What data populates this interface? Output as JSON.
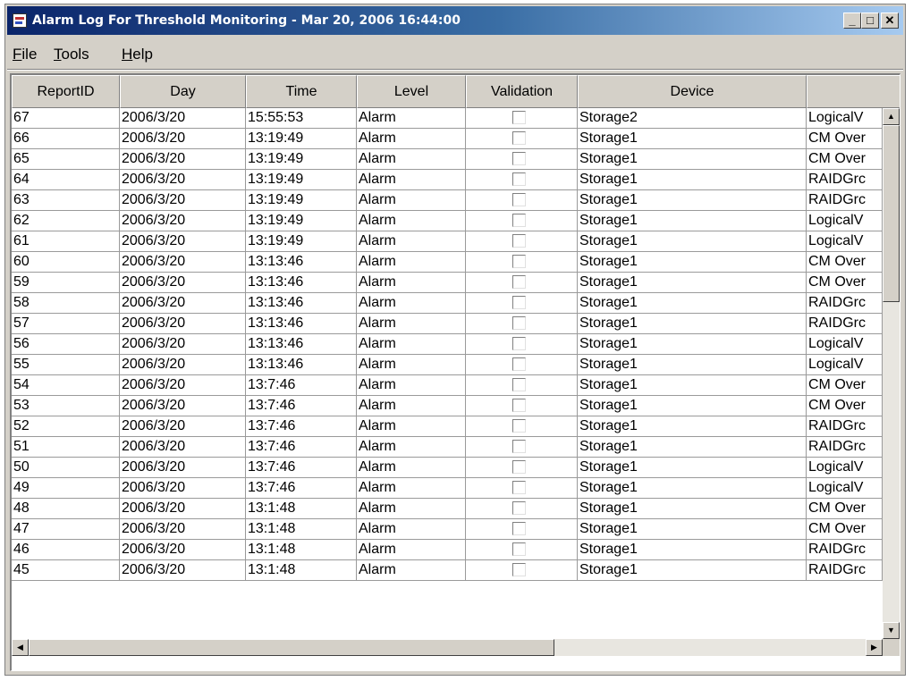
{
  "window": {
    "title": "Alarm Log For Threshold Monitoring - Mar 20, 2006 16:44:00",
    "minimize_label": "_",
    "maximize_label": "□",
    "close_label": "✕"
  },
  "menu": {
    "file_mnemonic": "F",
    "file_rest": "ile",
    "tools_mnemonic": "T",
    "tools_rest": "ools",
    "help_mnemonic": "H",
    "help_rest": "elp"
  },
  "table": {
    "columns": [
      "ReportID",
      "Day",
      "Time",
      "Level",
      "Validation",
      "Device",
      ""
    ],
    "rows": [
      {
        "id": "67",
        "day": "2006/3/20",
        "time": "15:55:53",
        "level": "Alarm",
        "validation": false,
        "device": "Storage2",
        "extra": "LogicalV"
      },
      {
        "id": "66",
        "day": "2006/3/20",
        "time": "13:19:49",
        "level": "Alarm",
        "validation": false,
        "device": "Storage1",
        "extra": "CM Over"
      },
      {
        "id": "65",
        "day": "2006/3/20",
        "time": "13:19:49",
        "level": "Alarm",
        "validation": false,
        "device": "Storage1",
        "extra": "CM Over"
      },
      {
        "id": "64",
        "day": "2006/3/20",
        "time": "13:19:49",
        "level": "Alarm",
        "validation": false,
        "device": "Storage1",
        "extra": "RAIDGrc"
      },
      {
        "id": "63",
        "day": "2006/3/20",
        "time": "13:19:49",
        "level": "Alarm",
        "validation": false,
        "device": "Storage1",
        "extra": "RAIDGrc"
      },
      {
        "id": "62",
        "day": "2006/3/20",
        "time": "13:19:49",
        "level": "Alarm",
        "validation": false,
        "device": "Storage1",
        "extra": "LogicalV"
      },
      {
        "id": "61",
        "day": "2006/3/20",
        "time": "13:19:49",
        "level": "Alarm",
        "validation": false,
        "device": "Storage1",
        "extra": "LogicalV"
      },
      {
        "id": "60",
        "day": "2006/3/20",
        "time": "13:13:46",
        "level": "Alarm",
        "validation": false,
        "device": "Storage1",
        "extra": "CM Over"
      },
      {
        "id": "59",
        "day": "2006/3/20",
        "time": "13:13:46",
        "level": "Alarm",
        "validation": false,
        "device": "Storage1",
        "extra": "CM Over"
      },
      {
        "id": "58",
        "day": "2006/3/20",
        "time": "13:13:46",
        "level": "Alarm",
        "validation": false,
        "device": "Storage1",
        "extra": "RAIDGrc"
      },
      {
        "id": "57",
        "day": "2006/3/20",
        "time": "13:13:46",
        "level": "Alarm",
        "validation": false,
        "device": "Storage1",
        "extra": "RAIDGrc"
      },
      {
        "id": "56",
        "day": "2006/3/20",
        "time": "13:13:46",
        "level": "Alarm",
        "validation": false,
        "device": "Storage1",
        "extra": "LogicalV"
      },
      {
        "id": "55",
        "day": "2006/3/20",
        "time": "13:13:46",
        "level": "Alarm",
        "validation": false,
        "device": "Storage1",
        "extra": "LogicalV"
      },
      {
        "id": "54",
        "day": "2006/3/20",
        "time": "13:7:46",
        "level": "Alarm",
        "validation": false,
        "device": "Storage1",
        "extra": "CM Over"
      },
      {
        "id": "53",
        "day": "2006/3/20",
        "time": "13:7:46",
        "level": "Alarm",
        "validation": false,
        "device": "Storage1",
        "extra": "CM Over"
      },
      {
        "id": "52",
        "day": "2006/3/20",
        "time": "13:7:46",
        "level": "Alarm",
        "validation": false,
        "device": "Storage1",
        "extra": "RAIDGrc"
      },
      {
        "id": "51",
        "day": "2006/3/20",
        "time": "13:7:46",
        "level": "Alarm",
        "validation": false,
        "device": "Storage1",
        "extra": "RAIDGrc"
      },
      {
        "id": "50",
        "day": "2006/3/20",
        "time": "13:7:46",
        "level": "Alarm",
        "validation": false,
        "device": "Storage1",
        "extra": "LogicalV"
      },
      {
        "id": "49",
        "day": "2006/3/20",
        "time": "13:7:46",
        "level": "Alarm",
        "validation": false,
        "device": "Storage1",
        "extra": "LogicalV"
      },
      {
        "id": "48",
        "day": "2006/3/20",
        "time": "13:1:48",
        "level": "Alarm",
        "validation": false,
        "device": "Storage1",
        "extra": "CM Over"
      },
      {
        "id": "47",
        "day": "2006/3/20",
        "time": "13:1:48",
        "level": "Alarm",
        "validation": false,
        "device": "Storage1",
        "extra": "CM Over"
      },
      {
        "id": "46",
        "day": "2006/3/20",
        "time": "13:1:48",
        "level": "Alarm",
        "validation": false,
        "device": "Storage1",
        "extra": "RAIDGrc"
      },
      {
        "id": "45",
        "day": "2006/3/20",
        "time": "13:1:48",
        "level": "Alarm",
        "validation": false,
        "device": "Storage1",
        "extra": "RAIDGrc"
      }
    ]
  },
  "scrollbars": {
    "up_arrow": "▲",
    "down_arrow": "▼",
    "left_arrow": "◀",
    "right_arrow": "▶"
  }
}
